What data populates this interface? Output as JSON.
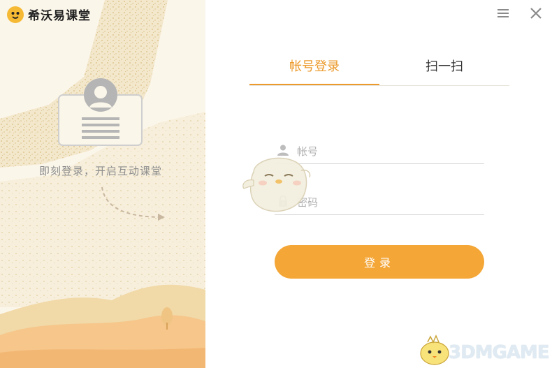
{
  "app": {
    "title": "希沃易课堂",
    "logo_icon": "chick-face-icon"
  },
  "window_controls": {
    "menu_icon": "hamburger-menu-icon",
    "close_icon": "close-icon"
  },
  "left_panel": {
    "slogan": "即刻登录，开启互动课堂",
    "accent_color": "#ec9a2c",
    "background_color": "#f6efdf"
  },
  "tabs": [
    {
      "label": "帐号登录",
      "active": true
    },
    {
      "label": "扫一扫",
      "active": false
    }
  ],
  "form": {
    "account": {
      "placeholder": "帐号",
      "value": "",
      "icon": "user-icon"
    },
    "password": {
      "placeholder": "密码",
      "value": "",
      "icon": "lock-icon"
    },
    "submit_label": "登录",
    "button_color": "#f4a636"
  },
  "watermark": {
    "text": "3DMGAME"
  }
}
